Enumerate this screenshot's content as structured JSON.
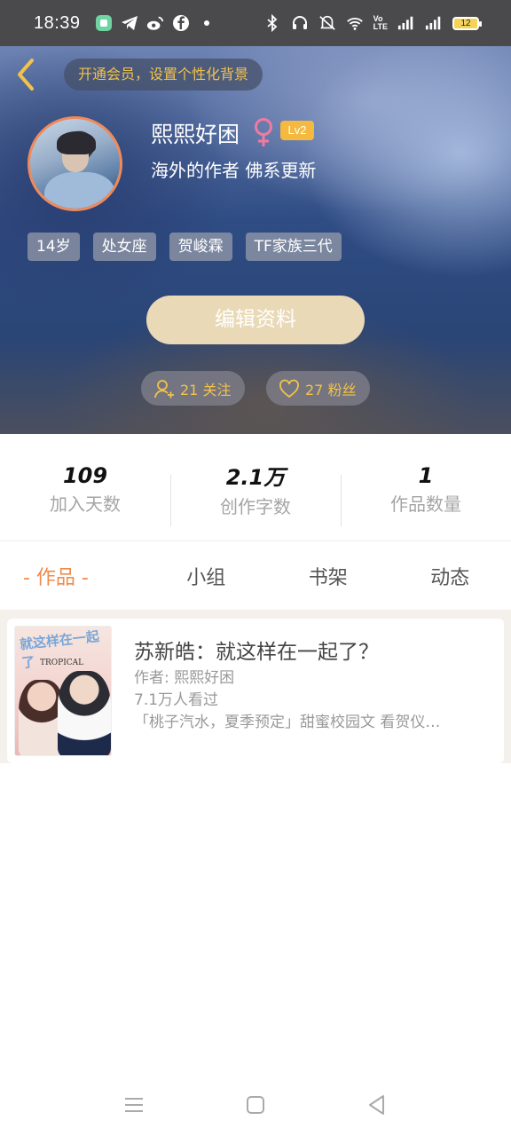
{
  "status_bar": {
    "time": "18:39",
    "left_icons": [
      "app-icon",
      "telegram-icon",
      "weibo-icon",
      "facebook-icon",
      "dot-icon"
    ],
    "right_icons": [
      "bluetooth-icon",
      "headphones-icon",
      "mute-icon",
      "wifi-icon",
      "volte-icon",
      "signal-icon",
      "signal-icon"
    ],
    "network_label_top": "Vo",
    "network_label_bottom": "LTE",
    "battery": "12"
  },
  "header": {
    "vip_prompt": "开通会员，设置个性化背景",
    "nickname": "熙熙好困",
    "gender": "female",
    "level": "Lv2",
    "bio": "海外的作者 佛系更新",
    "tags": [
      "14岁",
      "处女座",
      "贺峻霖",
      "TF家族三代"
    ],
    "edit_button": "编辑资料",
    "follow_label": "21 关注",
    "fans_label": "27 粉丝",
    "accent_color": "#f2c24a"
  },
  "stats": [
    {
      "value": "109",
      "label": "加入天数"
    },
    {
      "value": "2.1万",
      "label": "创作字数"
    },
    {
      "value": "1",
      "label": "作品数量"
    }
  ],
  "tabs": [
    {
      "label": "- 作品 -",
      "active": true
    },
    {
      "label": "小组",
      "active": false
    },
    {
      "label": "书架",
      "active": false
    },
    {
      "label": "动态",
      "active": false
    }
  ],
  "works": [
    {
      "title": "苏新皓：就这样在一起了？",
      "author": "作者: 熙熙好困",
      "views": "7.1万人看过",
      "description": "「桃子汽水，夏季预定」甜蜜校园文 看贺仪…",
      "cover_title": "就这样在一起了",
      "cover_subtitle": "TROPICAL"
    }
  ],
  "nav_bar": {
    "buttons": [
      "menu-icon",
      "home-icon",
      "back-icon"
    ]
  }
}
